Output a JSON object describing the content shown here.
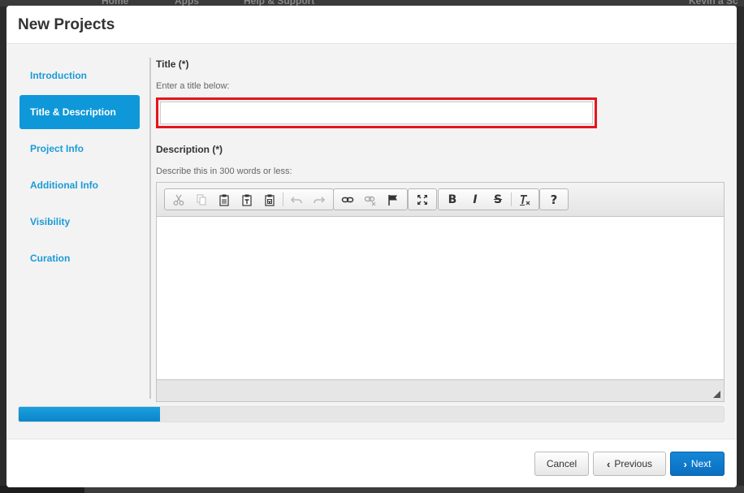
{
  "backdrop": {
    "nav": [
      "Home",
      "Apps",
      "Help & Support",
      "Kevin a Sc"
    ]
  },
  "modal": {
    "title": "New Projects"
  },
  "sidebar": {
    "items": [
      {
        "label": "Introduction",
        "active": false
      },
      {
        "label": "Title & Description",
        "active": true
      },
      {
        "label": "Project Info",
        "active": false
      },
      {
        "label": "Additional Info",
        "active": false
      },
      {
        "label": "Visibility",
        "active": false
      },
      {
        "label": "Curation",
        "active": false
      }
    ]
  },
  "form": {
    "title_label": "Title (*)",
    "title_hint": "Enter a title below:",
    "title_value": "",
    "description_label": "Description (*)",
    "description_hint": "Describe this in 300 words or less:",
    "description_value": ""
  },
  "editor": {
    "toolbar_icons": [
      "cut-icon",
      "copy-icon",
      "paste-icon",
      "paste-text-icon",
      "paste-word-icon",
      "undo-icon",
      "redo-icon",
      "link-icon",
      "unlink-icon",
      "anchor-icon",
      "maximize-icon",
      "bold-icon",
      "italic-icon",
      "strikethrough-icon",
      "remove-format-icon",
      "help-icon"
    ],
    "bold": "B",
    "italic": "I",
    "strike": "S",
    "clear": "Ix",
    "help": "?"
  },
  "progress": {
    "fraction": 0.2
  },
  "footer": {
    "cancel_label": "Cancel",
    "previous_label": "Previous",
    "next_label": "Next"
  },
  "colors": {
    "accent": "#0f98d9",
    "highlight_border": "#e8141b",
    "primary_button": "#0b6ec0"
  }
}
